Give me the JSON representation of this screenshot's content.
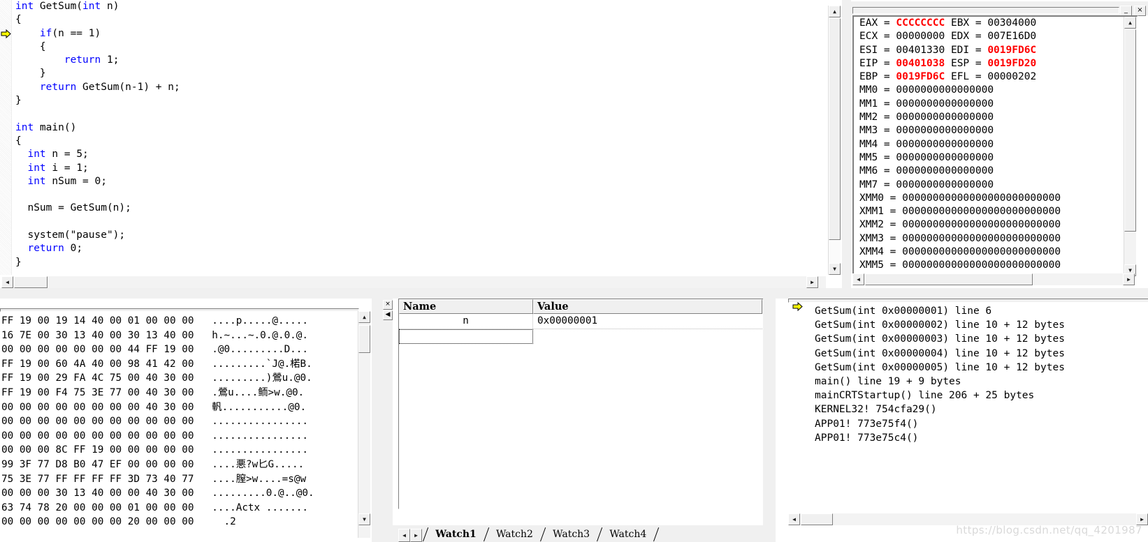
{
  "app": {
    "title": "Visual C++ Debugger"
  },
  "source": {
    "name": "source-code-pane",
    "current_line_marker": "execution-arrow",
    "lines": [
      [
        {
          "t": "int ",
          "c": "kw"
        },
        {
          "t": "GetSum(",
          "c": ""
        },
        {
          "t": "int",
          "c": "kw"
        },
        {
          "t": " n)",
          "c": ""
        }
      ],
      [
        {
          "t": "{",
          "c": ""
        }
      ],
      [
        {
          "t": "    ",
          "c": ""
        },
        {
          "t": "if",
          "c": "kw"
        },
        {
          "t": "(n == 1)",
          "c": ""
        }
      ],
      [
        {
          "t": "    {",
          "c": ""
        }
      ],
      [
        {
          "t": "        ",
          "c": ""
        },
        {
          "t": "return",
          "c": "kw"
        },
        {
          "t": " 1;",
          "c": ""
        }
      ],
      [
        {
          "t": "    }",
          "c": ""
        }
      ],
      [
        {
          "t": "    ",
          "c": ""
        },
        {
          "t": "return",
          "c": "kw"
        },
        {
          "t": " GetSum(n-1) + n;",
          "c": ""
        }
      ],
      [
        {
          "t": "}",
          "c": ""
        }
      ],
      [
        {
          "t": "",
          "c": ""
        }
      ],
      [
        {
          "t": "int ",
          "c": "kw"
        },
        {
          "t": "main()",
          "c": ""
        }
      ],
      [
        {
          "t": "{",
          "c": ""
        }
      ],
      [
        {
          "t": "  ",
          "c": ""
        },
        {
          "t": "int",
          "c": "kw"
        },
        {
          "t": " n = 5;",
          "c": ""
        }
      ],
      [
        {
          "t": "  ",
          "c": ""
        },
        {
          "t": "int",
          "c": "kw"
        },
        {
          "t": " i = 1;",
          "c": ""
        }
      ],
      [
        {
          "t": "  ",
          "c": ""
        },
        {
          "t": "int",
          "c": "kw"
        },
        {
          "t": " nSum = 0;",
          "c": ""
        }
      ],
      [
        {
          "t": "",
          "c": ""
        }
      ],
      [
        {
          "t": "  nSum = GetSum(n);",
          "c": ""
        }
      ],
      [
        {
          "t": "",
          "c": ""
        }
      ],
      [
        {
          "t": "  system(\"pause\");",
          "c": ""
        }
      ],
      [
        {
          "t": "  ",
          "c": ""
        },
        {
          "t": "return",
          "c": "kw"
        },
        {
          "t": " 0;",
          "c": ""
        }
      ],
      [
        {
          "t": "}",
          "c": ""
        }
      ]
    ],
    "arrow_line_index": 2
  },
  "registers": {
    "title": "Registers",
    "highlight_color": "#ff0000",
    "rows": [
      [
        {
          "n": "EAX",
          "v": "CCCCCCCC",
          "hot": true
        },
        {
          "n": "EBX",
          "v": "00304000",
          "hot": false
        }
      ],
      [
        {
          "n": "ECX",
          "v": "00000000",
          "hot": false
        },
        {
          "n": "EDX",
          "v": "007E16D0",
          "hot": false
        }
      ],
      [
        {
          "n": "ESI",
          "v": "00401330",
          "hot": false
        },
        {
          "n": "EDI",
          "v": "0019FD6C",
          "hot": true
        }
      ],
      [
        {
          "n": "EIP",
          "v": "00401038",
          "hot": true
        },
        {
          "n": "ESP",
          "v": "0019FD20",
          "hot": true
        }
      ],
      [
        {
          "n": "EBP",
          "v": "0019FD6C",
          "hot": true
        },
        {
          "n": "EFL",
          "v": "00000202",
          "hot": false
        }
      ]
    ],
    "mm": [
      {
        "n": "MM0",
        "v": "0000000000000000"
      },
      {
        "n": "MM1",
        "v": "0000000000000000"
      },
      {
        "n": "MM2",
        "v": "0000000000000000"
      },
      {
        "n": "MM3",
        "v": "0000000000000000"
      },
      {
        "n": "MM4",
        "v": "0000000000000000"
      },
      {
        "n": "MM5",
        "v": "0000000000000000"
      },
      {
        "n": "MM6",
        "v": "0000000000000000"
      },
      {
        "n": "MM7",
        "v": "0000000000000000"
      }
    ],
    "xmm": [
      {
        "n": "XMM0",
        "v": "00000000000000000000000000"
      },
      {
        "n": "XMM1",
        "v": "00000000000000000000000000"
      },
      {
        "n": "XMM2",
        "v": "00000000000000000000000000"
      },
      {
        "n": "XMM3",
        "v": "00000000000000000000000000"
      },
      {
        "n": "XMM4",
        "v": "00000000000000000000000000"
      },
      {
        "n": "XMM5",
        "v": "00000000000000000000000000"
      }
    ]
  },
  "memory": {
    "title": "Memory",
    "rows": [
      {
        "hex": "FF 19 00 19 14 40 00 01 00 00 00",
        "ascii": "....p.....@....."
      },
      {
        "hex": "16 7E 00 30 13 40 00 30 13 40 00",
        "ascii": "h.~...~.0.@.0.@."
      },
      {
        "hex": "00 00 00 00 00 00 00 44 FF 19 00",
        "ascii": ".@0.........D..."
      },
      {
        "hex": "FF 19 00 60 4A 40 00 98 41 42 00",
        "ascii": ".........`J@.楉B."
      },
      {
        "hex": "FF 19 00 29 FA 4C 75 00 40 30 00",
        "ascii": ".........)鶯u.@0."
      },
      {
        "hex": "FF 19 00 F4 75 3E 77 00 40 30 00",
        "ascii": ".鶯u....鲕>w.@0."
      },
      {
        "hex": "00 00 00 00 00 00 00 00 40 30 00",
        "ascii": "軓...........@0."
      },
      {
        "hex": "00 00 00 00 00 00 00 00 00 00 00",
        "ascii": "................"
      },
      {
        "hex": "00 00 00 00 00 00 00 00 00 00 00",
        "ascii": "................"
      },
      {
        "hex": "00 00 00 8C FF 19 00 00 00 00 00",
        "ascii": "................"
      },
      {
        "hex": "99 3F 77 D8 B0 47 EF 00 00 00 00",
        "ascii": "....悪?w匕G....."
      },
      {
        "hex": "75 3E 77 FF FF FF FF 3D 73 40 77",
        "ascii": "....膣>w....=s@w"
      },
      {
        "hex": "00 00 00 30 13 40 00 00 40 30 00",
        "ascii": ".........0.@..@0."
      },
      {
        "hex": "63 74 78 20 00 00 00 01 00 00 00",
        "ascii": "....Actx ......."
      },
      {
        "hex": "00 00 00 00 00 00 00 20 00 00 00",
        "ascii": "  .2"
      }
    ]
  },
  "watch": {
    "title": "Watch",
    "columns": [
      "Name",
      "Value"
    ],
    "rows": [
      {
        "name": "n",
        "value": "0x00000001"
      }
    ],
    "empty_row_placeholder": "",
    "tabs": [
      {
        "label": "Watch1",
        "active": true
      },
      {
        "label": "Watch2",
        "active": false
      },
      {
        "label": "Watch3",
        "active": false
      },
      {
        "label": "Watch4",
        "active": false
      }
    ]
  },
  "callstack": {
    "title": "Call Stack",
    "current_marker": "execution-arrow",
    "frames": [
      {
        "text": "GetSum(int 0x00000001) line 6",
        "current": true
      },
      {
        "text": "GetSum(int 0x00000002) line 10 + 12 bytes",
        "current": false
      },
      {
        "text": "GetSum(int 0x00000003) line 10 + 12 bytes",
        "current": false
      },
      {
        "text": "GetSum(int 0x00000004) line 10 + 12 bytes",
        "current": false
      },
      {
        "text": "GetSum(int 0x00000005) line 10 + 12 bytes",
        "current": false
      },
      {
        "text": "main() line 19 + 9 bytes",
        "current": false
      },
      {
        "text": "mainCRTStartup() line 206 + 25 bytes",
        "current": false
      },
      {
        "text": "KERNEL32! 754cfa29()",
        "current": false
      },
      {
        "text": "APP01! 773e75f4()",
        "current": false
      },
      {
        "text": "APP01! 773e75c4()",
        "current": false
      }
    ]
  },
  "window_buttons": {
    "restore": "_",
    "close": "×"
  },
  "panel_buttons": {
    "close": "×",
    "dock_left": "◀"
  },
  "scroll": {
    "up": "▲",
    "down": "▼",
    "left": "◀",
    "right": "▶"
  },
  "watermark": {
    "text": "https://blog.csdn.net/qq_4201987"
  }
}
